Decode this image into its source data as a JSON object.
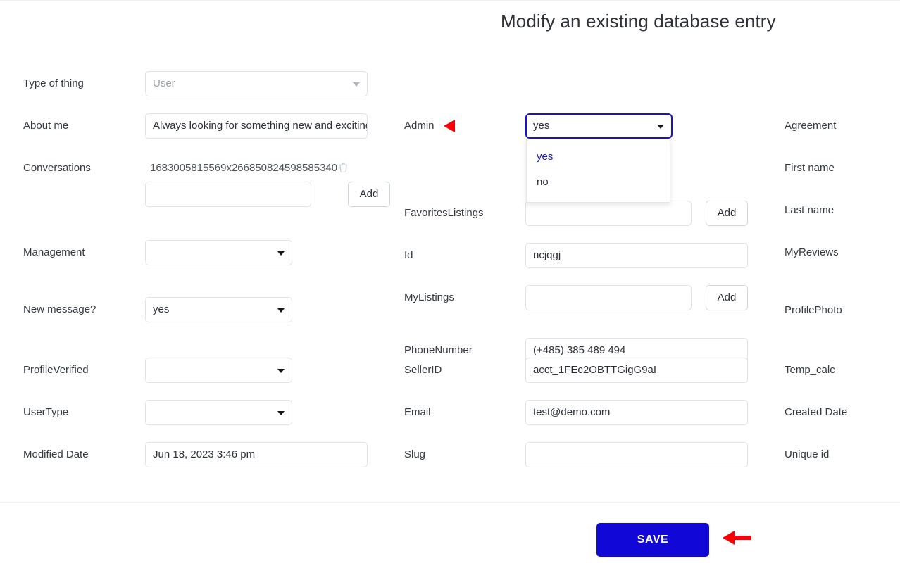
{
  "header": {
    "title": "Modify an existing database entry"
  },
  "columns": {
    "left": [
      {
        "label": "Type of thing",
        "control": "select",
        "value": "User",
        "disabled": true
      },
      {
        "label": "About me",
        "control": "input",
        "value": "Always looking for something new and exciting"
      },
      {
        "label": "Conversations",
        "control": "list",
        "items": [
          "1683005815569x266850824598585340"
        ],
        "add_label": "Add",
        "new_value": "",
        "delete_icon": "trash-icon"
      },
      {
        "label": "Management",
        "control": "select",
        "value": ""
      },
      {
        "label": "New message?",
        "control": "select",
        "value": "yes"
      },
      {
        "label": "ProfileVerified",
        "control": "select",
        "value": ""
      },
      {
        "label": "UserType",
        "control": "select",
        "value": ""
      },
      {
        "label": "Modified Date",
        "control": "input",
        "value": "Jun 18, 2023 3:46 pm"
      }
    ],
    "middle": [
      {
        "label": "Admin",
        "control": "select",
        "value": "yes",
        "open": true,
        "options": [
          "yes",
          "no"
        ],
        "selected": "yes"
      },
      {
        "label": "FavoritesListings",
        "control": "list",
        "items": [],
        "add_label": "Add",
        "new_value": ""
      },
      {
        "label": "Id",
        "control": "input",
        "value": "ncjqgj"
      },
      {
        "label": "MyListings",
        "control": "list",
        "items": [],
        "add_label": "Add",
        "new_value": ""
      },
      {
        "label": "PhoneNumber",
        "control": "input",
        "value": "(+485) 385 489 494"
      },
      {
        "label": "SellerID",
        "control": "input",
        "value": "acct_1FEc2OBTTGigG9aI"
      },
      {
        "label": "Email",
        "control": "input",
        "value": "test@demo.com"
      },
      {
        "label": "Slug",
        "control": "input",
        "value": ""
      }
    ],
    "right": [
      {
        "label": "Agreement"
      },
      {
        "label": "First name"
      },
      {
        "label": "Last name"
      },
      {
        "label": "MyReviews"
      },
      {
        "label": "ProfilePhoto"
      },
      {
        "label": "Temp_calc"
      },
      {
        "label": "Created Date"
      },
      {
        "label": "Unique id"
      }
    ]
  },
  "footer": {
    "save_label": "SAVE"
  },
  "annotations": {
    "admin_label_arrow": "red-arrow-left",
    "yes_option_arrow": "red-arrow-left",
    "save_button_arrow": "red-arrow-left"
  },
  "colors": {
    "accent_blue": "#1108d8",
    "focus_blue": "#1a0fd6",
    "annotation_red": "#fb0007",
    "label_gray": "#343a40",
    "border_gray": "#dfe3e6"
  }
}
